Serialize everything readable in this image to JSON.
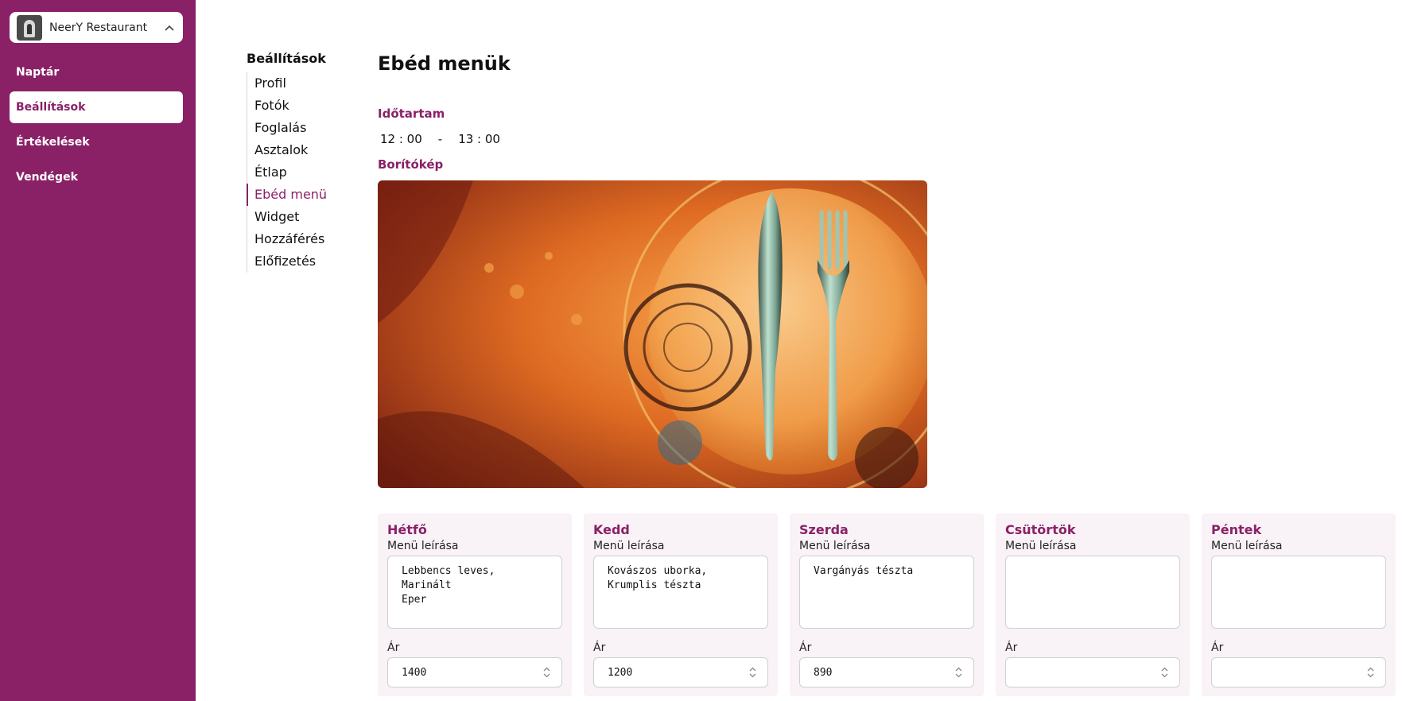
{
  "restaurant": {
    "name": "NeerY Restaurant"
  },
  "sidebar": {
    "items": [
      {
        "label": "Naptár"
      },
      {
        "label": "Beállítások"
      },
      {
        "label": "Értékelések"
      },
      {
        "label": "Vendégek"
      }
    ]
  },
  "settings_nav": {
    "title": "Beállítások",
    "items": [
      "Profil",
      "Fotók",
      "Foglalás",
      "Asztalok",
      "Étlap",
      "Ebéd menü",
      "Widget",
      "Hozzáférés",
      "Előfizetés"
    ]
  },
  "page": {
    "title": "Ebéd menük",
    "duration_label": "Időtartam",
    "start_time": "12 : 00",
    "separator": "-",
    "end_time": "13 : 00",
    "cover_label": "Borítókép"
  },
  "days": [
    {
      "name": "Hétfő",
      "desc_label": "Menü leírása",
      "description": "Lebbencs leves, Marinált\nEper",
      "price_label": "Ár",
      "price": "1400"
    },
    {
      "name": "Kedd",
      "desc_label": "Menü leírása",
      "description": "Kovászos uborka,\nKrumplis tészta",
      "price_label": "Ár",
      "price": "1200"
    },
    {
      "name": "Szerda",
      "desc_label": "Menü leírása",
      "description": "Vargányás tészta",
      "price_label": "Ár",
      "price": "890"
    },
    {
      "name": "Csütörtök",
      "desc_label": "Menü leírása",
      "description": "",
      "price_label": "Ár",
      "price": ""
    },
    {
      "name": "Péntek",
      "desc_label": "Menü leírása",
      "description": "",
      "price_label": "Ár",
      "price": ""
    }
  ],
  "colors": {
    "brand": "#8a2167",
    "card_bg": "#f9f2f7"
  }
}
